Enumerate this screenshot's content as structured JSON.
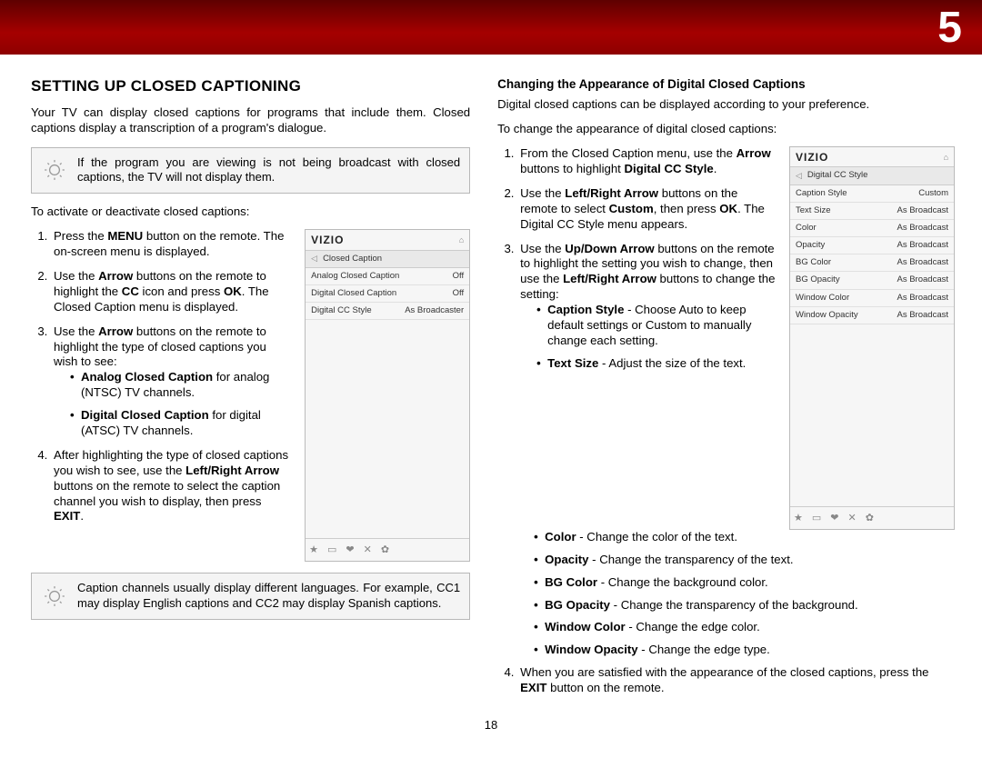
{
  "chapter": "5",
  "page_number": "18",
  "left": {
    "heading": "SETTING UP CLOSED CAPTIONING",
    "intro": "Your TV can display closed captions for programs that include them. Closed captions display a transcription of a program's dialogue.",
    "tip1": "If the program you are viewing is not being broadcast with closed captions, the TV will not display them.",
    "lead": "To activate or deactivate closed captions:",
    "steps": {
      "s1a": "Press the ",
      "s1b": "MENU",
      "s1c": " button on the remote. The on-screen menu is displayed.",
      "s2a": "Use the ",
      "s2b": "Arrow",
      "s2c": " buttons on the remote to highlight the ",
      "s2d": "CC",
      "s2e": " icon and press ",
      "s2f": "OK",
      "s2g": ". The Closed Caption menu is displayed.",
      "s3a": "Use the ",
      "s3b": "Arrow",
      "s3c": " buttons on the remote to highlight the type of closed captions you wish to see:",
      "s3i1a": "Analog Closed Caption",
      "s3i1b": " for analog (NTSC) TV channels.",
      "s3i2a": "Digital Closed Caption",
      "s3i2b": " for digital (ATSC) TV channels.",
      "s4a": "After highlighting the type of closed captions you wish to see, use the ",
      "s4b": "Left/Right Arrow",
      "s4c": " buttons on the remote to select the caption channel you wish to display, then press ",
      "s4d": "EXIT",
      "s4e": "."
    },
    "tip2": "Caption channels usually display different languages. For example, CC1 may display English captions and CC2 may display Spanish captions.",
    "osd": {
      "brand": "VIZIO",
      "title": "Closed Caption",
      "rows": [
        {
          "label": "Analog Closed Caption",
          "value": "Off"
        },
        {
          "label": "Digital Closed Caption",
          "value": "Off"
        },
        {
          "label": "Digital CC Style",
          "value": "As Broadcaster"
        }
      ]
    }
  },
  "right": {
    "heading": "Changing the Appearance of Digital Closed Captions",
    "intro": "Digital closed captions can be displayed according to your preference.",
    "lead": "To change the appearance of digital closed captions:",
    "steps": {
      "s1a": "From the Closed Caption menu, use the ",
      "s1b": "Arrow",
      "s1c": " buttons to highlight ",
      "s1d": "Digital CC Style",
      "s1e": ".",
      "s2a": "Use the ",
      "s2b": "Left/Right Arrow",
      "s2c": " buttons on the remote to select ",
      "s2d": "Custom",
      "s2e": ", then press ",
      "s2f": "OK",
      "s2g": ". The Digital CC Style menu appears.",
      "s3a": "Use the ",
      "s3b": "Up/Down Arrow",
      "s3c": " buttons on the remote to highlight the setting you wish to change, then use the ",
      "s3d": "Left/Right Arrow",
      "s3e": " buttons to change the setting:",
      "items": {
        "i1a": "Caption Style",
        "i1b": " - Choose Auto to keep default settings or Custom to manually change each setting.",
        "i2a": "Text Size",
        "i2b": " - Adjust the size of the text.",
        "i3a": "Color",
        "i3b": " - Change the color of the text.",
        "i4a": "Opacity",
        "i4b": " - Change the transparency of the text.",
        "i5a": "BG Color",
        "i5b": " - Change the background color.",
        "i6a": "BG Opacity",
        "i6b": " - Change the transparency of the background.",
        "i7a": "Window Color",
        "i7b": " - Change the edge color.",
        "i8a": "Window Opacity",
        "i8b": " - Change the edge type."
      },
      "s4a": "When you are satisfied with the appearance of the closed captions, press the ",
      "s4b": "EXIT",
      "s4c": " button on the remote."
    },
    "osd": {
      "brand": "VIZIO",
      "title": "Digital CC Style",
      "rows": [
        {
          "label": "Caption Style",
          "value": "Custom"
        },
        {
          "label": "Text Size",
          "value": "As Broadcast"
        },
        {
          "label": "Color",
          "value": "As Broadcast"
        },
        {
          "label": "Opacity",
          "value": "As Broadcast"
        },
        {
          "label": "BG Color",
          "value": "As Broadcast"
        },
        {
          "label": "BG Opacity",
          "value": "As Broadcast"
        },
        {
          "label": "Window Color",
          "value": "As Broadcast"
        },
        {
          "label": "Window Opacity",
          "value": "As Broadcast"
        }
      ]
    }
  },
  "icons": {
    "star": "★",
    "pip": "▭",
    "v": "❤",
    "x": "✕",
    "gear": "✿",
    "home": "⌂",
    "back": "◁"
  }
}
